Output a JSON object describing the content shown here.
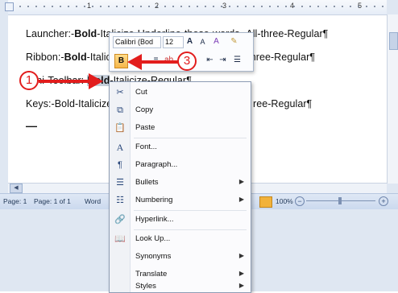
{
  "ruler": {
    "numbers": [
      "1",
      "2",
      "3",
      "4",
      "5"
    ]
  },
  "document": {
    "line1": {
      "label": "Launcher:-",
      "bold": "Bold",
      "rest": "-Italicize-Underline-those-words.-All-three-Regular¶"
    },
    "line2": {
      "label": "Ribbon:-",
      "bold": "Bold",
      "mid": "-Italic",
      "tail": "-three-Regular¶"
    },
    "line3": {
      "label": "Mini-Toolbar:-",
      "bold": "Bold",
      "rest": "-Italicize-Regular¶"
    },
    "line4": {
      "label": "Keys:-Bold-Italicize",
      "tail": "ree-Regular¶"
    },
    "line5": "—"
  },
  "mini_toolbar": {
    "font": "Calibri (Bod",
    "size": "12",
    "bold_label": "B",
    "grow_font": "A",
    "shrink_font": "A",
    "color_a": "A"
  },
  "callouts": {
    "c1": "1",
    "c3": "3"
  },
  "status_bar": {
    "page": "Page: 1",
    "page_of": "Page: 1 of 1",
    "words": "Word",
    "zoom": "100%"
  },
  "context_menu": {
    "items": [
      {
        "label": "Cut",
        "icon": "scissors-icon",
        "glyph": "✂"
      },
      {
        "label": "Copy",
        "icon": "copy-icon",
        "glyph": "⧉"
      },
      {
        "label": "Paste",
        "icon": "paste-icon",
        "glyph": "📋"
      },
      {
        "label": "Font...",
        "icon": "font-icon",
        "glyph": "A"
      },
      {
        "label": "Paragraph...",
        "icon": "paragraph-icon",
        "glyph": "¶"
      },
      {
        "label": "Bullets",
        "icon": "bullets-icon",
        "glyph": "☰",
        "submenu": "▶"
      },
      {
        "label": "Numbering",
        "icon": "numbering-icon",
        "glyph": "☷",
        "submenu": "▶"
      },
      {
        "label": "Hyperlink...",
        "icon": "hyperlink-icon",
        "glyph": "🔗"
      },
      {
        "label": "Look Up...",
        "icon": "lookup-icon",
        "glyph": "📖"
      },
      {
        "label": "Synonyms",
        "icon": "",
        "glyph": "",
        "submenu": "▶"
      },
      {
        "label": "Translate",
        "icon": "",
        "glyph": "",
        "submenu": "▶"
      },
      {
        "label": "Styles",
        "icon": "",
        "glyph": "",
        "submenu": "▶"
      }
    ]
  },
  "colors": {
    "callout": "#e21d1d",
    "highlight": "#f6b74a",
    "selection": "#c5ced9"
  }
}
